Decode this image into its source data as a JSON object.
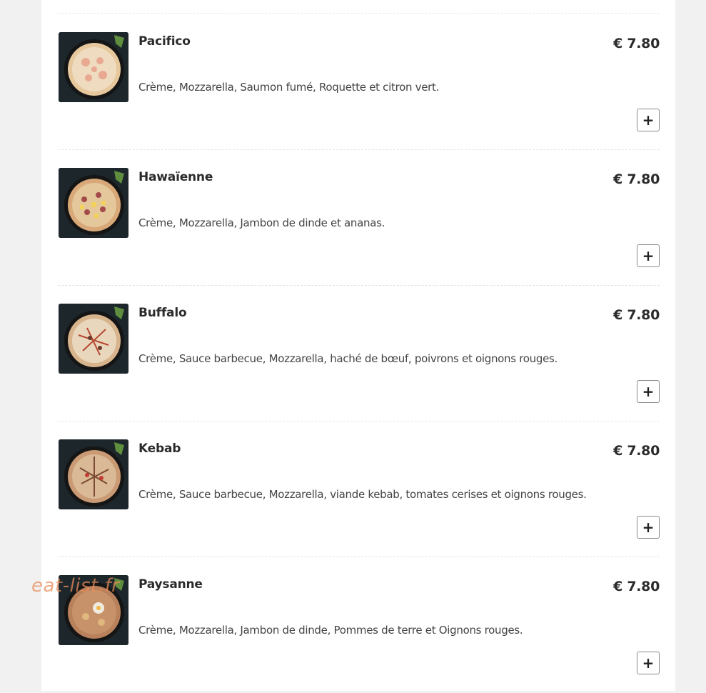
{
  "menu": {
    "items": [
      {
        "name": "Pacifico",
        "price": "€ 7.80",
        "description": "Crème, Mozzarella, Saumon fumé, Roquette et citron vert.",
        "add_label": "+"
      },
      {
        "name": "Hawaïenne",
        "price": "€ 7.80",
        "description": "Crème, Mozzarella, Jambon de dinde et ananas.",
        "add_label": "+"
      },
      {
        "name": "Buffalo",
        "price": "€ 7.80",
        "description": "Crème, Sauce barbecue, Mozzarella, haché de bœuf, poivrons et oignons rouges.",
        "add_label": "+"
      },
      {
        "name": "Kebab",
        "price": "€ 7.80",
        "description": "Crème, Sauce barbecue, Mozzarella, viande kebab, tomates cerises et oignons rouges.",
        "add_label": "+"
      },
      {
        "name": "Paysanne",
        "price": "€ 7.80",
        "description": "Crème, Mozzarella, Jambon de dinde, Pommes de terre et Oignons rouges.",
        "add_label": "+"
      }
    ]
  },
  "watermark": "eat-list.fr",
  "colors": {
    "background": "#f1f1f1",
    "panel": "#ffffff",
    "text_dark": "#2b2b2b",
    "watermark": "#e88c5a"
  },
  "icons": {
    "add": "plus-icon",
    "thumbnail": "pizza-image"
  }
}
